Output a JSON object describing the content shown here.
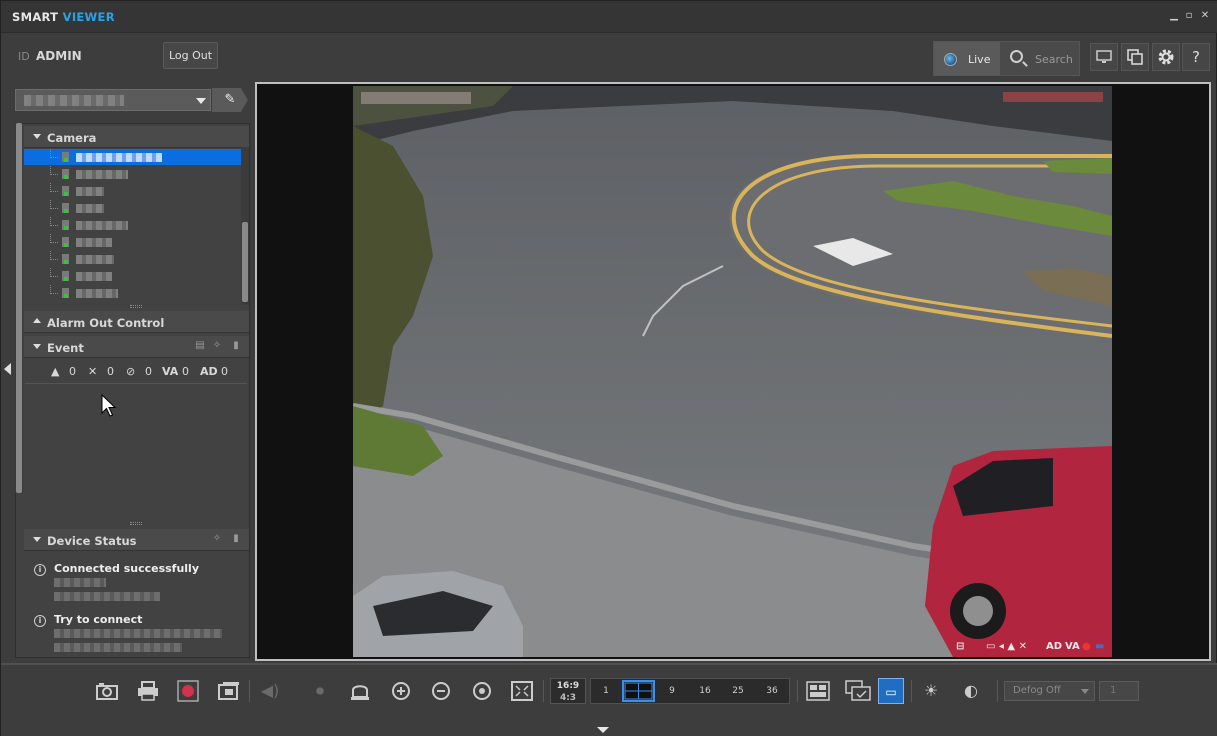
{
  "app": {
    "brand_part1": "SMART",
    "brand_part2": "VIEWER",
    "window_controls": [
      "minimize-icon",
      "maximize-icon",
      "close-icon"
    ]
  },
  "header": {
    "id_label": "ID",
    "username": "ADMIN",
    "logout_label": "Log Out",
    "mode_tabs": [
      {
        "label": "Live",
        "icon": "live-icon",
        "active": true
      },
      {
        "label": "Search",
        "icon": "search-icon",
        "active": false
      }
    ],
    "right_icons": [
      "monitor-icon",
      "layout-icon",
      "settings-icon",
      "help-icon"
    ],
    "help_glyph": "?"
  },
  "sidebar": {
    "site_select_value": "",
    "sections": {
      "camera": "Camera",
      "alarm_out": "Alarm Out Control",
      "event": "Event",
      "device_status": "Device Status"
    },
    "event_counts": [
      {
        "icon": "alarm-icon",
        "value": "0"
      },
      {
        "icon": "motion-icon",
        "value": "0"
      },
      {
        "icon": "video-loss-icon",
        "value": "0"
      },
      {
        "label": "VA",
        "value": "0"
      },
      {
        "label": "AD",
        "value": "0"
      }
    ],
    "device_status": [
      {
        "status": "Connected successfully"
      },
      {
        "status": "Try to connect"
      }
    ]
  },
  "video": {
    "osd_labels": [
      "AD",
      "VA"
    ]
  },
  "toolbar": {
    "ratio_top": "16:9",
    "ratio_bottom": "4:3",
    "layouts": [
      "1",
      "4",
      "9",
      "16",
      "25",
      "36"
    ],
    "selected_layout": "4",
    "defog_value": "Defog Off",
    "defog_level": "1"
  },
  "colors": {
    "accent": "#29a3e6",
    "selection": "#0a6ee0",
    "panel_bg": "#424242"
  }
}
